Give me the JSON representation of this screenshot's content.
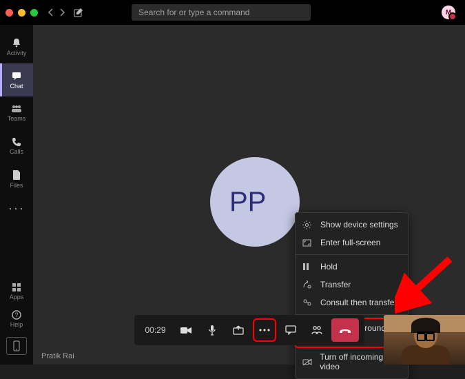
{
  "titlebar": {
    "search_placeholder": "Search for or type a command",
    "avatar_initial": "M"
  },
  "rail": {
    "items": [
      {
        "id": "activity",
        "label": "Activity",
        "icon": "bell"
      },
      {
        "id": "chat",
        "label": "Chat",
        "icon": "chat",
        "active": true
      },
      {
        "id": "teams",
        "label": "Teams",
        "icon": "teams"
      },
      {
        "id": "calls",
        "label": "Calls",
        "icon": "phone"
      },
      {
        "id": "files",
        "label": "Files",
        "icon": "file"
      }
    ],
    "overflow": "···",
    "bottom": [
      {
        "id": "apps",
        "label": "Apps",
        "icon": "apps"
      },
      {
        "id": "help",
        "label": "Help",
        "icon": "help"
      }
    ]
  },
  "call": {
    "participant_initials": "PP",
    "timer": "00:29",
    "footer_name": "Pratik Rai"
  },
  "menu": {
    "items": [
      {
        "id": "device",
        "label": "Show device settings",
        "icon": "gear"
      },
      {
        "id": "fullscreen",
        "label": "Enter full-screen",
        "icon": "fullscreen"
      },
      {
        "sep": true
      },
      {
        "id": "hold",
        "label": "Hold",
        "icon": "pause"
      },
      {
        "id": "transfer",
        "label": "Transfer",
        "icon": "transfer"
      },
      {
        "id": "consult",
        "label": "Consult then transfer",
        "icon": "consult"
      },
      {
        "sep": true
      },
      {
        "id": "bg",
        "label": "Show background effects",
        "icon": "bgfx",
        "highlight": true
      },
      {
        "id": "vidoff",
        "label": "Turn off incoming video",
        "icon": "novideo"
      }
    ]
  },
  "annotation": {
    "arrow_color": "#ff0000"
  }
}
